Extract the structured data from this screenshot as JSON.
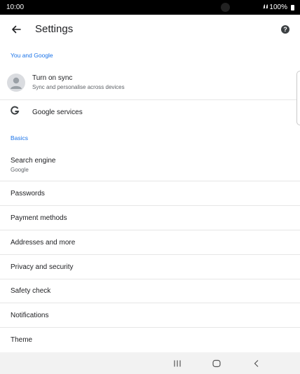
{
  "status_bar": {
    "time": "10:00",
    "battery": "100%"
  },
  "app_bar": {
    "title": "Settings",
    "back_icon": "arrow-back-icon",
    "help_icon": "help-icon"
  },
  "sections": {
    "you_and_google": "You and Google",
    "basics": "Basics"
  },
  "you_and_google": {
    "sync_title": "Turn on sync",
    "sync_subtitle": "Sync and personalise across devices",
    "google_services": "Google services"
  },
  "basics": {
    "search_engine": "Search engine",
    "search_engine_value": "Google",
    "items": [
      "Passwords",
      "Payment methods",
      "Addresses and more",
      "Privacy and security",
      "Safety check",
      "Notifications",
      "Theme"
    ]
  },
  "nav_bar": {
    "recents_icon": "recents-icon",
    "home_icon": "home-icon",
    "back_icon": "back-icon"
  },
  "colors": {
    "accent": "#1a73e8",
    "status_bar": "#000000",
    "nav_bar": "#f2f2f2"
  }
}
